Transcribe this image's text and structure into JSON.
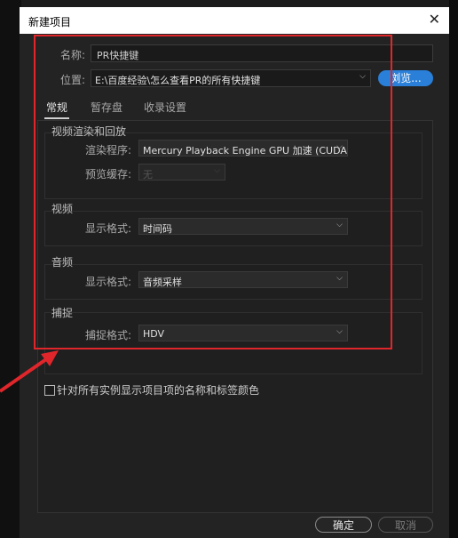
{
  "dialog": {
    "title": "新建项目",
    "close": "✕"
  },
  "name_field": {
    "label": "名称:",
    "value": "PR快捷键"
  },
  "location_field": {
    "label": "位置:",
    "value": "E:\\百度经验\\怎么查看PR的所有快捷键"
  },
  "browse_label": "浏览...",
  "tabs": [
    {
      "label": "常规",
      "active": true
    },
    {
      "label": "暂存盘",
      "active": false
    },
    {
      "label": "收录设置",
      "active": false
    }
  ],
  "groups": {
    "video_render": {
      "title": "视频渲染和回放",
      "renderer_label": "渲染程序:",
      "renderer_value": "Mercury Playback Engine GPU 加速 (CUDA)",
      "preview_cache_label": "预览缓存:",
      "preview_cache_value": "无"
    },
    "video": {
      "title": "视频",
      "display_format_label": "显示格式:",
      "display_format_value": "时间码"
    },
    "audio": {
      "title": "音频",
      "display_format_label": "显示格式:",
      "display_format_value": "音频采样"
    },
    "capture": {
      "title": "捕捉",
      "capture_format_label": "捕捉格式:",
      "capture_format_value": "HDV"
    }
  },
  "checkbox_label": "针对所有实例显示项目项的名称和标签颜色",
  "buttons": {
    "ok": "确定",
    "cancel": "取消"
  },
  "colors": {
    "accent": "#2a7fd8",
    "annotation": "#e0262b",
    "background": "#232323"
  },
  "icons": {
    "chevron": "chevron-down-icon",
    "close": "close-icon"
  }
}
